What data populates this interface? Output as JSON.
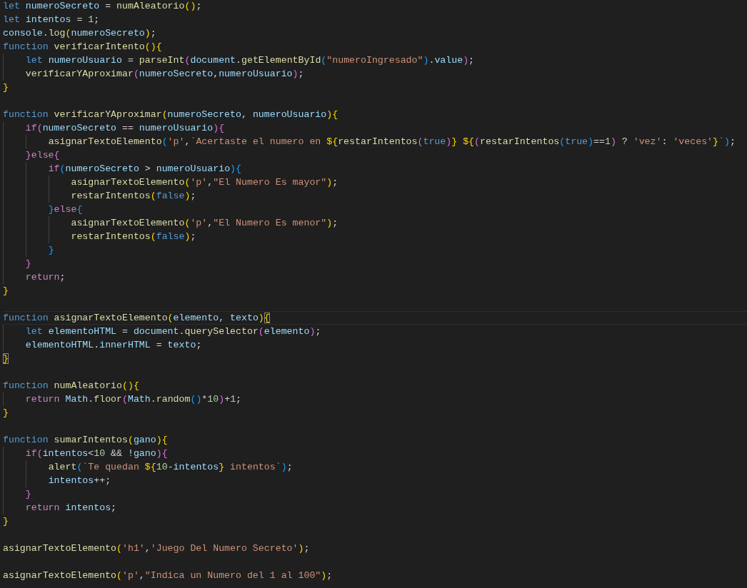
{
  "editor": {
    "lines": [
      {
        "text": "let numeroSecreto = numAleatorio();",
        "current": false
      },
      {
        "text": "let intentos = 1;",
        "current": false
      },
      {
        "text": "console.log(numeroSecreto);",
        "current": false
      },
      {
        "text": "function verificarIntento(){",
        "current": false
      },
      {
        "text": "    let numeroUsuario = parseInt(document.getElementById(\"numeroIngresado\").value);",
        "current": false
      },
      {
        "text": "    verificarYAproximar(numeroSecreto,numeroUsuario);",
        "current": false
      },
      {
        "text": "}",
        "current": false,
        "bracket_match": false
      },
      {
        "current": false
      },
      {
        "text": "function verificarYAproximar(numeroSecreto, numeroUsuario){",
        "current": false,
        "bracket_match": false
      },
      {
        "text": "    if(numeroSecreto == numeroUsuario){",
        "current": false
      },
      {
        "text": "        asignarTextoElemento('p',`Acertaste el numero en ${restarIntentos(true)} ${(restarIntentos(true)==1) ? 'vez': 'veces'}`);",
        "current": false
      },
      {
        "text": "    }else{",
        "current": false
      },
      {
        "text": "        if(numeroSecreto > numeroUsuario){",
        "current": false
      },
      {
        "text": "            asignarTextoElemento('p',\"El Numero Es mayor\");",
        "current": false
      },
      {
        "text": "            restarIntentos(false);",
        "current": false
      },
      {
        "text": "        }else{",
        "current": false
      },
      {
        "text": "            asignarTextoElemento('p',\"El Numero Es menor\");",
        "current": false
      },
      {
        "text": "            restarIntentos(false);",
        "current": false
      },
      {
        "text": "        }",
        "current": false
      },
      {
        "text": "    }",
        "current": false
      },
      {
        "text": "    return;",
        "current": false
      },
      {
        "text": "}",
        "current": false,
        "bracket_match": false
      },
      {
        "current": false
      },
      {
        "text": "function asignarTextoElemento(elemento, texto){",
        "current": true,
        "bracket_match": true
      },
      {
        "text": "    let elementoHTML = document.querySelector(elemento);",
        "current": false
      },
      {
        "text": "    elementoHTML.innerHTML = texto;",
        "current": false
      },
      {
        "text": "}",
        "current": false,
        "bracket_match": true
      },
      {
        "current": false
      },
      {
        "text": "function numAleatorio(){",
        "current": false
      },
      {
        "text": "    return Math.floor(Math.random()*10)+1;",
        "current": false
      },
      {
        "text": "}",
        "current": false
      },
      {
        "current": false
      },
      {
        "text": "function sumarIntentos(gano){",
        "current": false
      },
      {
        "text": "    if(intentos<10 && !gano){",
        "current": false
      },
      {
        "text": "        alert(`Te quedan ${10-intentos} intentos`);",
        "current": false
      },
      {
        "text": "        intentos++;",
        "current": false
      },
      {
        "text": "    }",
        "current": false
      },
      {
        "text": "    return intentos;",
        "current": false
      },
      {
        "text": "}",
        "current": false
      },
      {
        "current": false
      },
      {
        "text": "asignarTextoElemento('h1','Juego Del Numero Secreto');",
        "current": false
      },
      {
        "current": false
      },
      {
        "text": "asignarTextoElemento('p',\"Indica un Numero del 1 al 100\");",
        "current": false
      }
    ]
  }
}
